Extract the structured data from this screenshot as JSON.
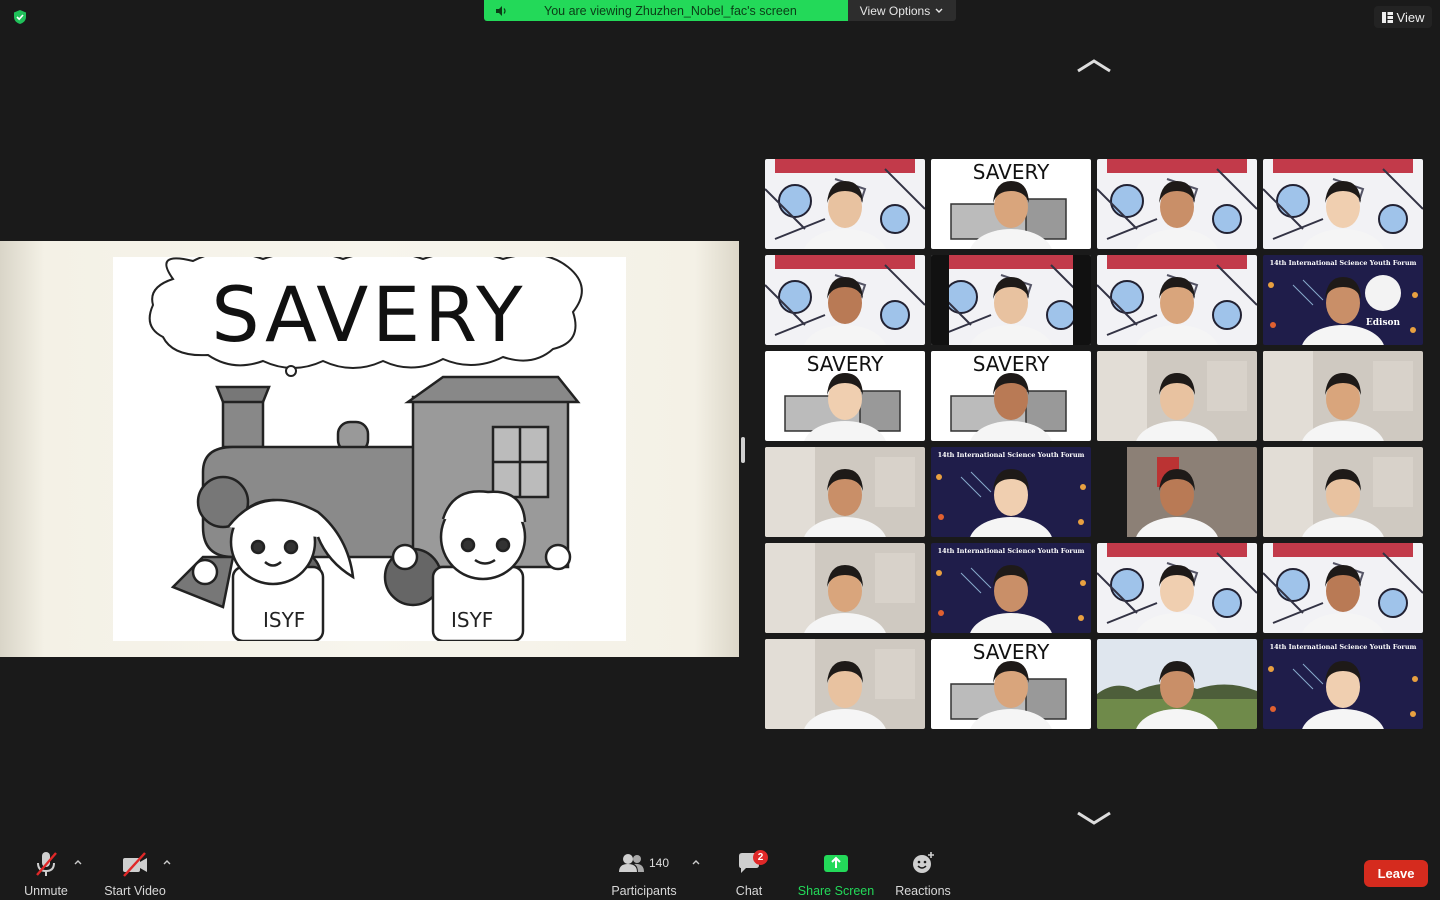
{
  "banner": {
    "text": "You are viewing Zhuzhen_Nobel_fac's screen",
    "view_options": "View Options"
  },
  "view_button": "View",
  "slide": {
    "title": "SAVERY",
    "shirt_left": "ISYF",
    "shirt_right": "ISYF"
  },
  "tiles": [
    {
      "bg": "cartoon",
      "label": ""
    },
    {
      "bg": "savery",
      "label": "SAVERY"
    },
    {
      "bg": "cartoon",
      "label": ""
    },
    {
      "bg": "cartoon",
      "label": ""
    },
    {
      "bg": "cartoon",
      "label": ""
    },
    {
      "bg": "cartoon-dark",
      "label": ""
    },
    {
      "bg": "cartoon",
      "label": ""
    },
    {
      "bg": "forum",
      "label": "14th International Science Youth Forum",
      "sub": "Edison"
    },
    {
      "bg": "savery",
      "label": "SAVERY"
    },
    {
      "bg": "savery",
      "label": "SAVERY"
    },
    {
      "bg": "room",
      "label": ""
    },
    {
      "bg": "room",
      "label": ""
    },
    {
      "bg": "room",
      "label": ""
    },
    {
      "bg": "forum",
      "label": "14th International Science Youth Forum"
    },
    {
      "bg": "room-dark",
      "label": ""
    },
    {
      "bg": "room",
      "label": ""
    },
    {
      "bg": "room",
      "label": ""
    },
    {
      "bg": "forum",
      "label": "14th International Science Youth Forum"
    },
    {
      "bg": "cartoon",
      "label": ""
    },
    {
      "bg": "cartoon",
      "label": ""
    },
    {
      "bg": "room",
      "label": ""
    },
    {
      "bg": "savery",
      "label": "SAVERY"
    },
    {
      "bg": "outdoor",
      "label": ""
    },
    {
      "bg": "forum",
      "label": "14th International Science Youth Forum"
    }
  ],
  "toolbar": {
    "unmute": "Unmute",
    "start_video": "Start Video",
    "participants_count": "140",
    "participants": "Participants",
    "chat": "Chat",
    "chat_badge": "2",
    "share_screen": "Share Screen",
    "reactions": "Reactions",
    "leave": "Leave"
  },
  "colors": {
    "banner_green": "#23d959",
    "share_green": "#23d959",
    "leave_red": "#d52b1e",
    "forum_navy": "#1f1d4a"
  }
}
